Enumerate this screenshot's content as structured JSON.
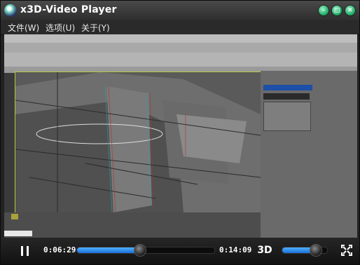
{
  "window": {
    "title": "x3D-Video Player",
    "controls": {
      "minimize": "–",
      "maximize": "□",
      "close": "✕"
    },
    "accent": "#1aa860"
  },
  "menu": {
    "items": [
      "文件(W)",
      "选项(U)",
      "关于(Y)"
    ]
  },
  "player": {
    "current_time": "0:06:29",
    "total_time": "0:14:09",
    "progress": 0.46,
    "volume": 0.75,
    "mode_button": "3D",
    "progress_color": "#2b8ef0"
  }
}
